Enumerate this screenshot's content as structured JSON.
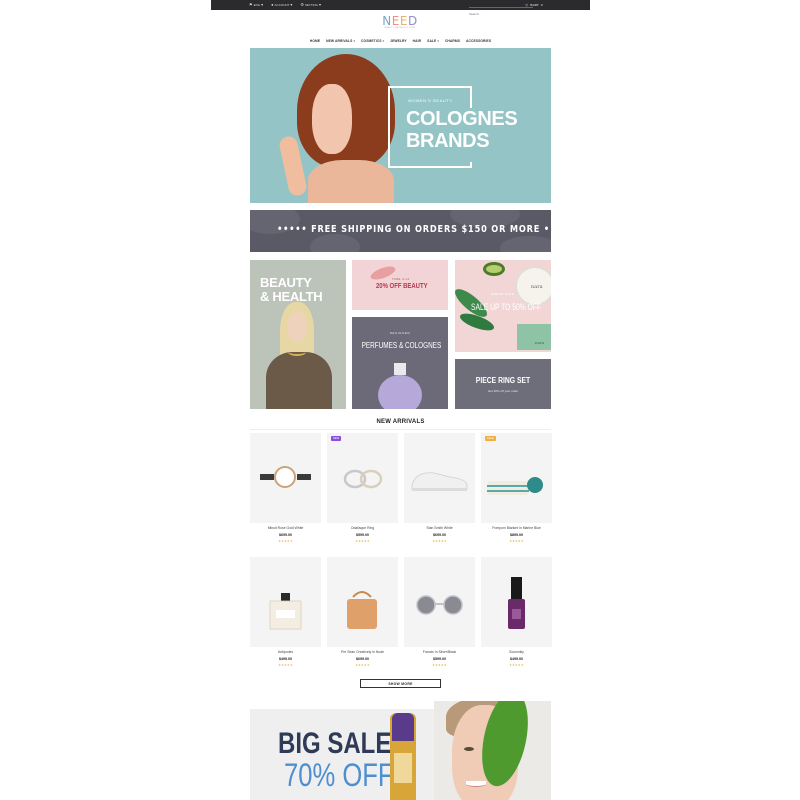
{
  "topbar": {
    "language": "ENG",
    "account": "ACCOUNT",
    "settings": "SETTING",
    "search_placeholder": "Search...",
    "cart_label": "CART",
    "cart_count": "0"
  },
  "logo": {
    "letters": [
      "N",
      "E",
      "E",
      "D"
    ],
    "tagline": "BEAUTY FASHION STORE"
  },
  "nav": {
    "items": [
      {
        "label": "HOME"
      },
      {
        "label": "NEW ARRIVALS",
        "caret": "▾"
      },
      {
        "label": "COSMETICS",
        "caret": "▾"
      },
      {
        "label": "JEWELRY"
      },
      {
        "label": "HAIR"
      },
      {
        "label": "SALE",
        "caret": "▾"
      },
      {
        "label": "CHARMS"
      },
      {
        "label": "ACCESSORIES"
      }
    ]
  },
  "hero": {
    "kicker": "WOMEN'S BEAUTY",
    "title_line1": "COLOGNES",
    "title_line2": "BRANDS"
  },
  "shipping": {
    "text": "••••• FREE SHIPPING ON ORDERS $150 OR MORE •••••"
  },
  "tiles": {
    "beauty": {
      "line1": "BEAUTY",
      "line2": "& HEALTH"
    },
    "pink": {
      "kicker": "TIME 4-14",
      "label": "20% OFF BEAUTY"
    },
    "green": {
      "kicker": "DREAM SALE",
      "label": "SALE UP TO 50% OFF",
      "brand": "nara",
      "box_brand": "nara"
    },
    "perfume": {
      "kicker": "DESIGNER",
      "label": "PERFUMES & COLOGNES"
    },
    "ring": {
      "label": "PIECE RING SET",
      "sub": "Get 30% off your order"
    }
  },
  "new_arrivals": {
    "title": "NEW ARRIVALS",
    "products": [
      {
        "name": "Minuit Rose Gold White",
        "price": "$699.00",
        "stars": "★★★★★",
        "badge": ""
      },
      {
        "name": "Odalisque Ring",
        "price": "$599.00",
        "stars": "★★★★★",
        "badge": "NEW"
      },
      {
        "name": "Stan Smith White",
        "price": "$699.00",
        "stars": "★★★★★",
        "badge": ""
      },
      {
        "name": "Pompom Blanket In Marine Blue",
        "price": "$899.00",
        "stars": "★★★★★",
        "badge": "SALE"
      },
      {
        "name": "Antipodes",
        "price": "$499.00",
        "stars": "★★★★★",
        "badge": ""
      },
      {
        "name": "Pre Sean Creatively In Nude",
        "price": "$699.00",
        "stars": "★★★★★",
        "badge": ""
      },
      {
        "name": "Francis In Silver/Black",
        "price": "$599.00",
        "stars": "★★★★★",
        "badge": ""
      },
      {
        "name": "Soulonkly",
        "price": "$499.00",
        "stars": "★★★★★",
        "badge": ""
      }
    ],
    "show_more": "SHOW MORE"
  },
  "sale": {
    "headline": "BIG SALE",
    "percent": "70% OFF"
  },
  "colors": {
    "topbar": "#2b2b2d",
    "hero_bg": "#94c4c6",
    "new_badge": "#8a4fd8",
    "sale_badge": "#f0b040",
    "sale_blue": "#4e8fd0",
    "sale_navy": "#2e3a56"
  },
  "icons": {
    "flag": "flag-icon",
    "account": "user-icon",
    "settings": "gear-icon",
    "search": "search-icon",
    "cart": "cart-icon"
  }
}
